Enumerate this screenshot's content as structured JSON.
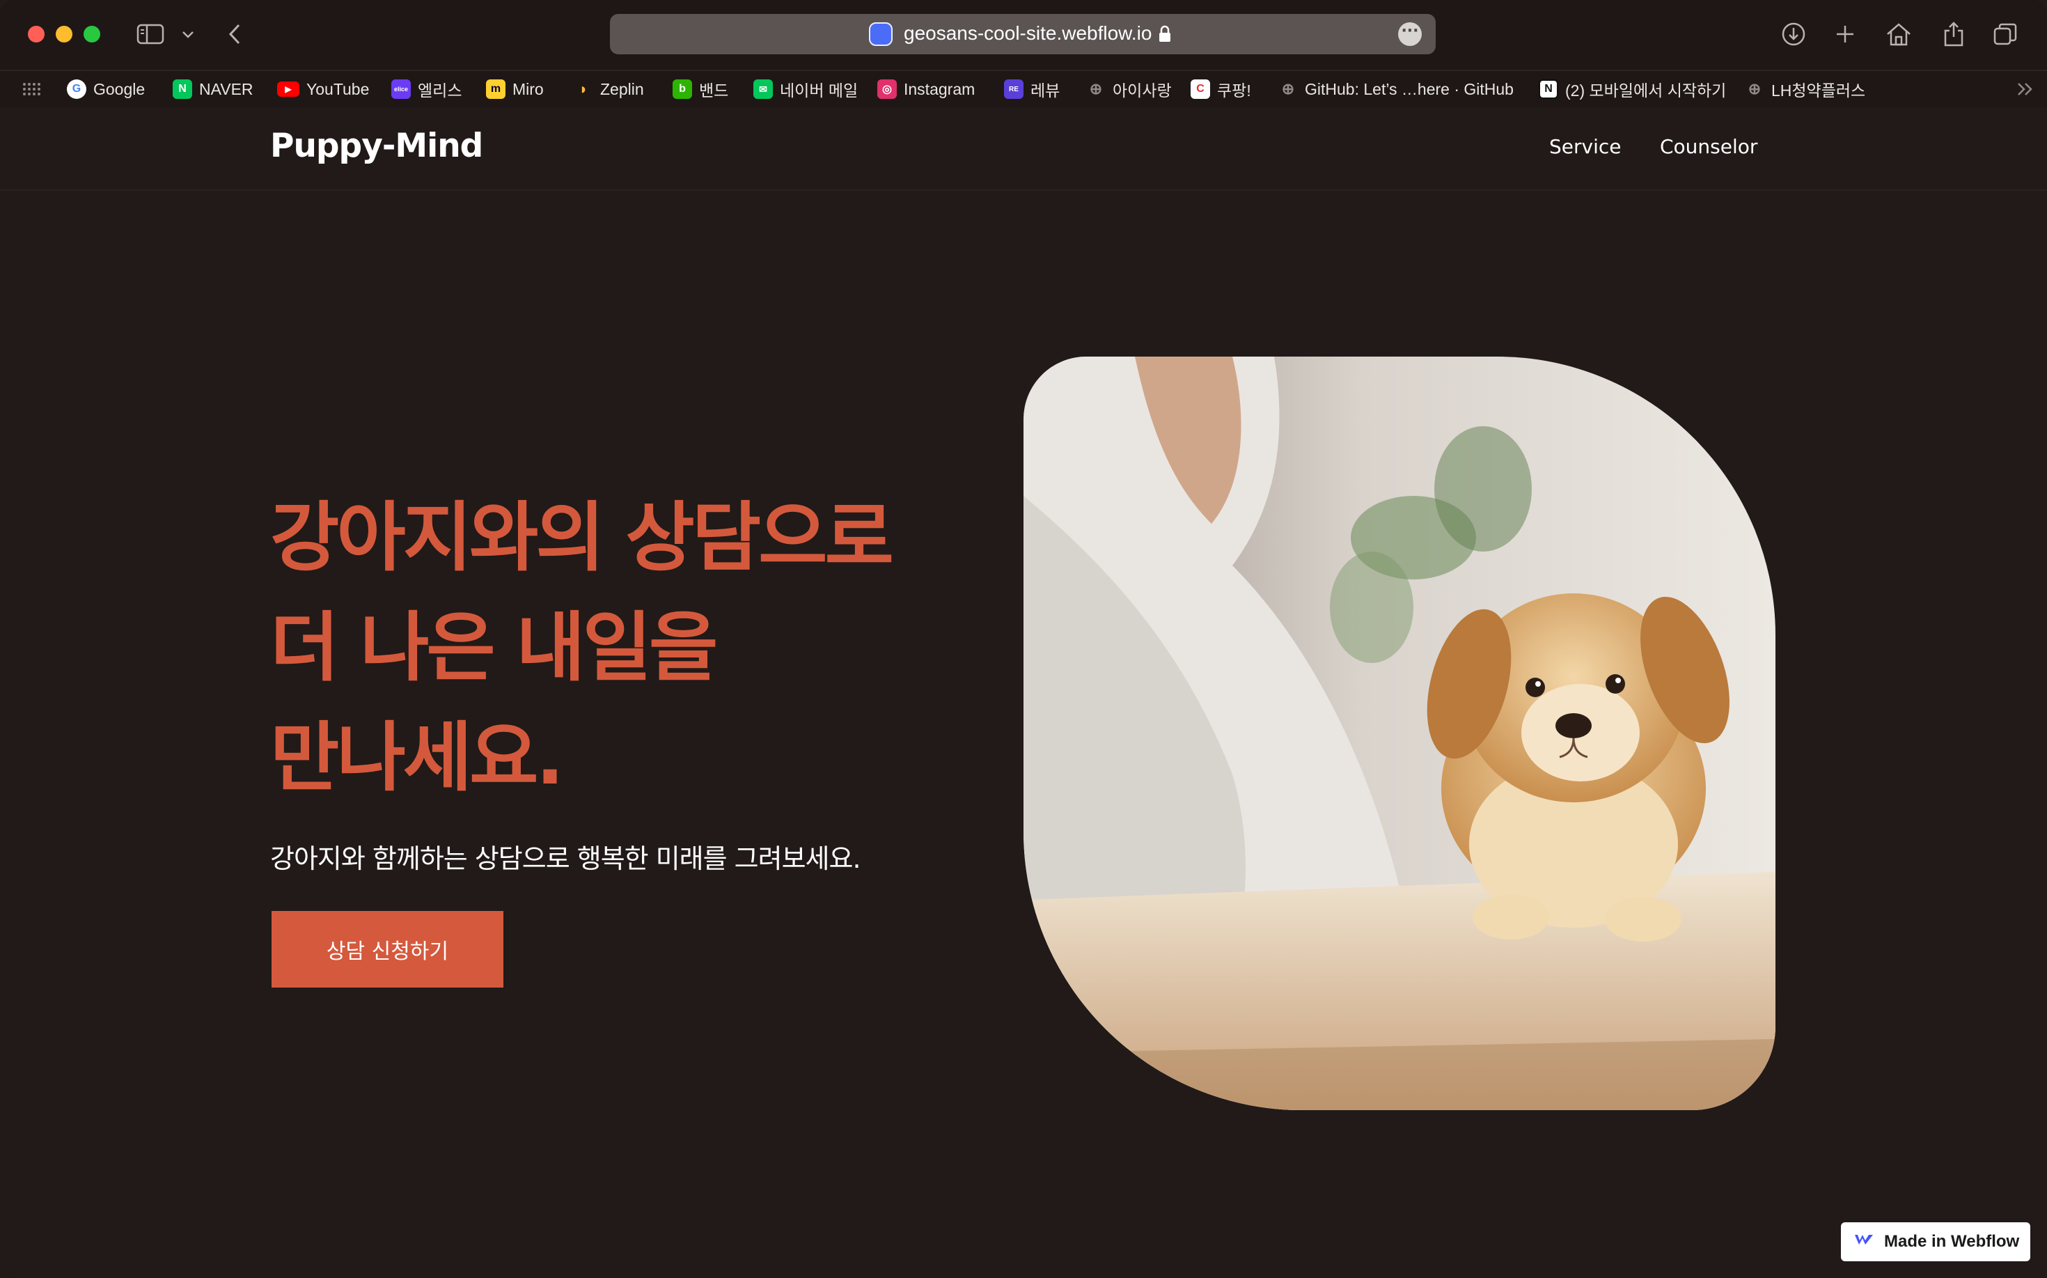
{
  "browser": {
    "url": "geosans-cool-site.webflow.io",
    "bookmarks": [
      {
        "label": "Google",
        "icon": "google-icon"
      },
      {
        "label": "NAVER",
        "icon": "naver-icon"
      },
      {
        "label": "YouTube",
        "icon": "youtube-icon"
      },
      {
        "label": "엘리스",
        "icon": "elice-icon"
      },
      {
        "label": "Miro",
        "icon": "miro-icon"
      },
      {
        "label": "Zeplin",
        "icon": "zeplin-icon"
      },
      {
        "label": "밴드",
        "icon": "band-icon"
      },
      {
        "label": "네이버 메일",
        "icon": "naver-mail-icon"
      },
      {
        "label": "Instagram",
        "icon": "instagram-icon"
      },
      {
        "label": "레뷰",
        "icon": "revu-icon"
      },
      {
        "label": "아이사랑",
        "icon": "globe-icon"
      },
      {
        "label": "쿠팡!",
        "icon": "coupang-icon"
      },
      {
        "label": "GitHub: Let’s …here · GitHub",
        "icon": "globe-icon"
      },
      {
        "label": "(2) 모바일에서 시작하기",
        "icon": "notion-icon"
      },
      {
        "label": "LH청약플러스",
        "icon": "globe-icon"
      }
    ]
  },
  "site": {
    "brand": "Puppy-Mind",
    "nav": [
      "Service",
      "Counselor"
    ],
    "hero": {
      "title_line1": "강아지와의 상담으로",
      "title_line2": "더 나은 내일을",
      "title_line3": "만나세요.",
      "subtitle": "강아지와 함께하는 상담으로 행복한 미래를 그려보세요.",
      "cta": "상담 신청하기"
    },
    "badge": "Made in Webflow"
  },
  "colors": {
    "background": "#211a18",
    "accent": "#d5593d",
    "text": "#ffffff"
  }
}
